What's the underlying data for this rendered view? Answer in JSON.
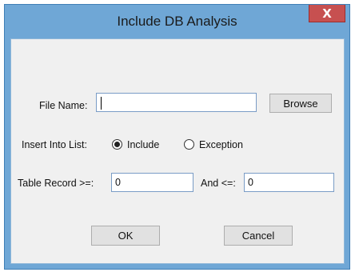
{
  "window": {
    "title": "Include DB Analysis",
    "close_glyph": "X",
    "close_color": "#c75050",
    "titlebar_color": "#6fa7d6"
  },
  "form": {
    "file_name_label": "File Name:",
    "file_name_value": "",
    "browse_label": "Browse",
    "insert_into_label": "Insert Into List:",
    "radio_include_label": "Include",
    "radio_exception_label": "Exception",
    "radio_selected": "include",
    "table_record_label": "Table Record >=:",
    "table_record_min": "0",
    "and_label": "And <=:",
    "table_record_max": "0"
  },
  "buttons": {
    "ok_label": "OK",
    "cancel_label": "Cancel"
  }
}
